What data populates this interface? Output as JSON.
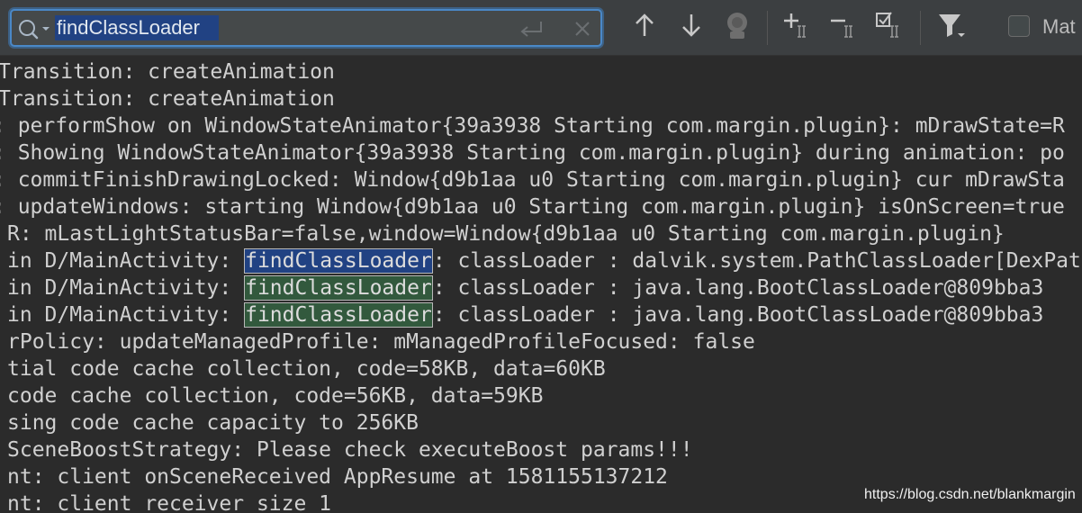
{
  "search": {
    "query": "findClassLoader"
  },
  "toolbar": {
    "match_case_label": "Mat"
  },
  "icons": {
    "search": "search-icon",
    "enter": "enter-icon",
    "clear": "clear-icon",
    "prev": "arrow-up-icon",
    "next": "arrow-down-icon",
    "regex": "regex-icon",
    "add_occurrence": "add-occurrence-icon",
    "remove_occurrence": "remove-occurrence-icon",
    "select_all": "select-all-occurrences-icon",
    "filter": "filter-icon"
  },
  "colors": {
    "background": "#2b2b2b",
    "toolbar": "#3c3f41",
    "search_border": "#4a88c7",
    "selection": "#214283",
    "match_highlight": "#32593d",
    "text": "#d0d0d0"
  },
  "log": {
    "lines": [
      {
        "text": "Transition: createAnimation",
        "x": -2
      },
      {
        "text": "Transition: createAnimation",
        "x": -2
      },
      {
        "text": ": performShow on WindowStateAnimator{39a3938 Starting com.margin.plugin}: mDrawState=R",
        "x": -8
      },
      {
        "text": ": Showing WindowStateAnimator{39a3938 Starting com.margin.plugin} during animation: po",
        "x": -8
      },
      {
        "text": ": commitFinishDrawingLocked: Window{d9b1aa u0 Starting com.margin.plugin} cur mDrawSta",
        "x": -8
      },
      {
        "text": ": updateWindows: starting Window{d9b1aa u0 Starting com.margin.plugin} isOnScreen=true",
        "x": -8
      },
      {
        "text": "R: mLastLightStatusBar=false,window=Window{d9b1aa u0 Starting com.margin.plugin}",
        "x": 8
      },
      {
        "pre": "in D/MainActivity: ",
        "match": "findClassLoader",
        "post": ": classLoader : dalvik.system.PathClassLoader[DexPat",
        "current": true,
        "x": 8
      },
      {
        "pre": "in D/MainActivity: ",
        "match": "findClassLoader",
        "post": ": classLoader : java.lang.BootClassLoader@809bba3",
        "current": false,
        "x": 8
      },
      {
        "pre": "in D/MainActivity: ",
        "match": "findClassLoader",
        "post": ": classLoader : java.lang.BootClassLoader@809bba3",
        "current": false,
        "x": 8
      },
      {
        "text": "rPolicy: updateManagedProfile: mManagedProfileFocused: false",
        "x": 8
      },
      {
        "text": "tial code cache collection, code=58KB, data=60KB",
        "x": 8
      },
      {
        "text": "code cache collection, code=56KB, data=59KB",
        "x": 8
      },
      {
        "text": "sing code cache capacity to 256KB",
        "x": 8
      },
      {
        "text": "SceneBoostStrategy: Please check executeBoost params!!!",
        "x": 8
      },
      {
        "text": "nt: client onSceneReceived AppResume at 1581155137212",
        "x": 8
      },
      {
        "text": "nt: client receiver size 1",
        "x": 8
      }
    ]
  },
  "watermark": "https://blog.csdn.net/blankmargin"
}
